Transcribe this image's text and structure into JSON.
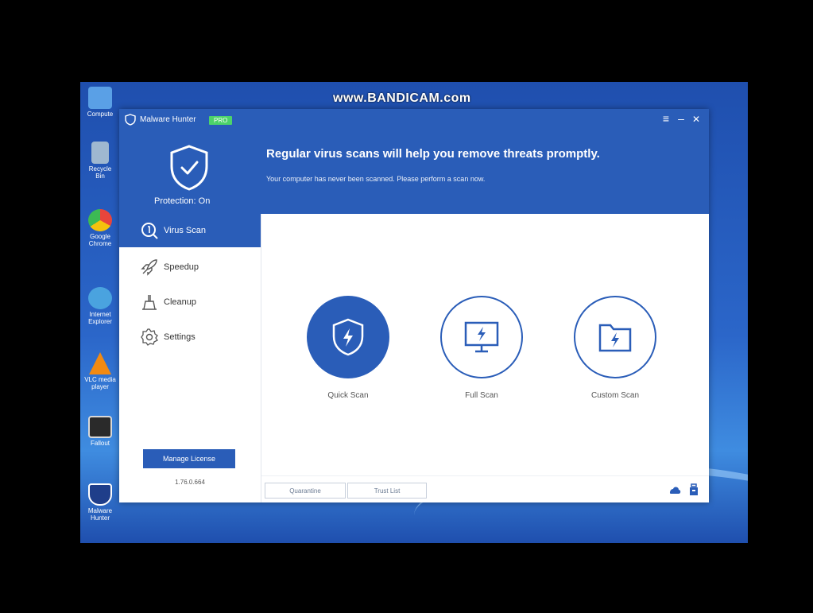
{
  "watermark": "www.BANDICAM.com",
  "desktop_icons": [
    {
      "label": "Compute",
      "icon": "computer-icon",
      "color": "#5aa0e6"
    },
    {
      "label": "Recycle Bin",
      "icon": "recycle-bin-icon",
      "color": "#9fb8d0"
    },
    {
      "label": "Google Chrome",
      "icon": "chrome-icon",
      "color": "#e8453c"
    },
    {
      "label": "Internet Explorer",
      "icon": "ie-icon",
      "color": "#4aa3df"
    },
    {
      "label": "VLC media player",
      "icon": "vlc-icon",
      "color": "#f28a12"
    },
    {
      "label": "Fallout",
      "icon": "app-icon",
      "color": "#2a2a2a"
    },
    {
      "label": "Malware Hunter",
      "icon": "malware-hunter-shortcut-icon",
      "color": "#1f3e8a"
    }
  ],
  "app": {
    "name": "Malware Hunter",
    "badge": "PRO",
    "title_buttons": {
      "menu": "≡",
      "minimize": "–",
      "close": "✕"
    },
    "status": "Protection: On",
    "headline": "Regular virus scans will help you remove threats promptly.",
    "subline": "Your computer has never been scanned. Please perform a scan now.",
    "accent": "#2a5db8",
    "nav": [
      {
        "label": "Virus Scan",
        "icon": "virus-scan-icon",
        "active": true
      },
      {
        "label": "Speedup",
        "icon": "rocket-icon",
        "active": false
      },
      {
        "label": "Cleanup",
        "icon": "broom-icon",
        "active": false
      },
      {
        "label": "Settings",
        "icon": "gear-icon",
        "active": false
      }
    ],
    "license_button": "Manage License",
    "version": "1.76.0.664",
    "scans": [
      {
        "label": "Quick Scan",
        "icon": "shield-bolt-icon"
      },
      {
        "label": "Full Scan",
        "icon": "monitor-bolt-icon"
      },
      {
        "label": "Custom Scan",
        "icon": "folder-bolt-icon"
      }
    ],
    "footer": {
      "quarantine": "Quarantine",
      "trust_list": "Trust List"
    }
  }
}
